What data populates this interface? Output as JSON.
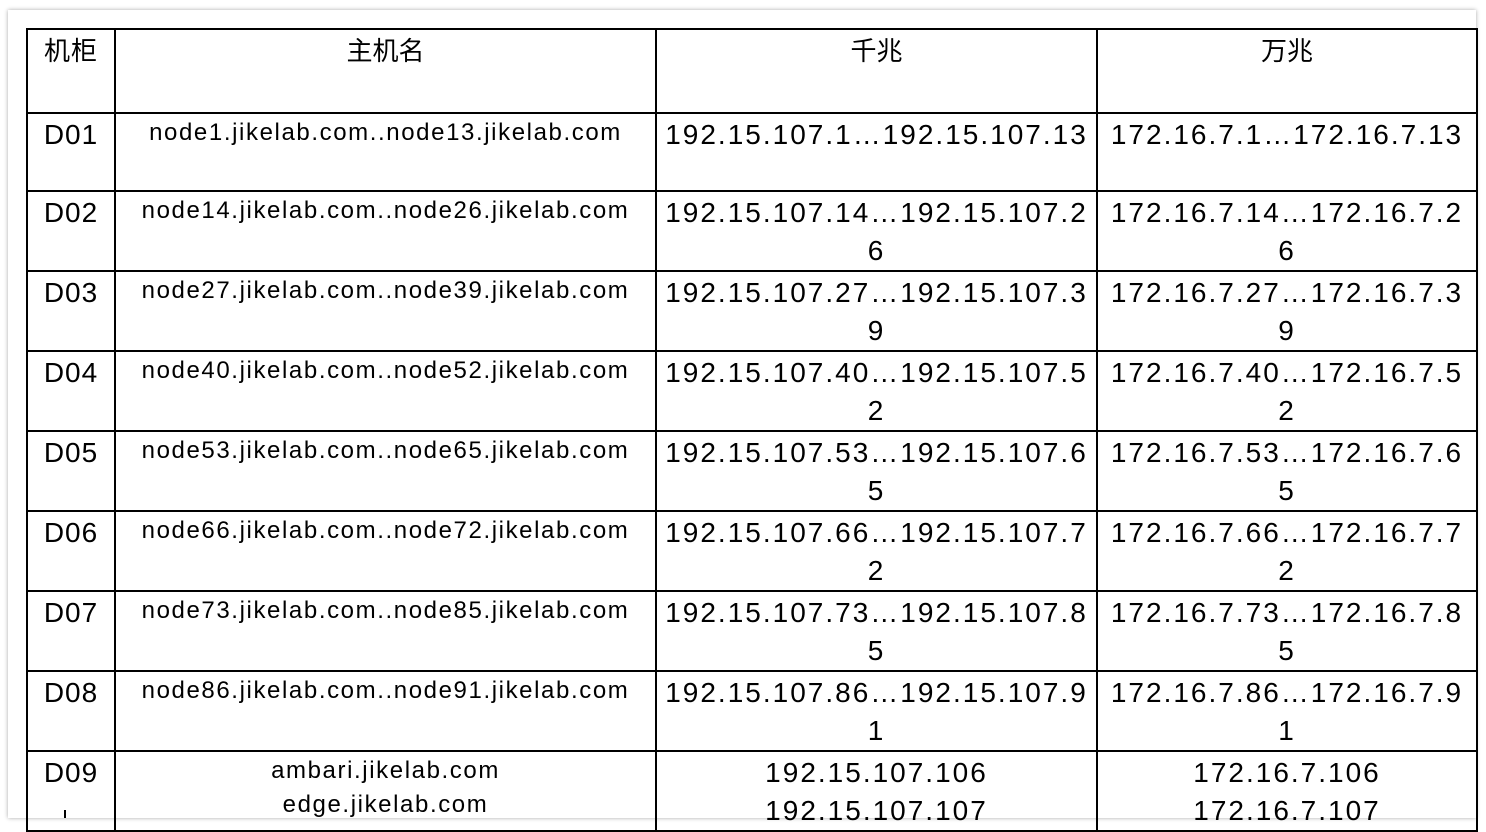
{
  "table": {
    "headers": [
      "机柜",
      "主机名",
      "千兆",
      "万兆"
    ],
    "rows": [
      {
        "rack": "D01",
        "host": "node1.jikelab.com..node13.jikelab.com",
        "gigabit": "192.15.107.1…192.15.107.13",
        "ten_gigabit": "172.16.7.1…172.16.7.13"
      },
      {
        "rack": "D02",
        "host": "node14.jikelab.com..node26.jikelab.com",
        "gigabit": "192.15.107.14…192.15.107.26",
        "ten_gigabit": "172.16.7.14…172.16.7.26"
      },
      {
        "rack": "D03",
        "host": "node27.jikelab.com..node39.jikelab.com",
        "gigabit": "192.15.107.27…192.15.107.39",
        "ten_gigabit": "172.16.7.27…172.16.7.39"
      },
      {
        "rack": "D04",
        "host": "node40.jikelab.com..node52.jikelab.com",
        "gigabit": "192.15.107.40…192.15.107.52",
        "ten_gigabit": "172.16.7.40…172.16.7.52"
      },
      {
        "rack": "D05",
        "host": "node53.jikelab.com..node65.jikelab.com",
        "gigabit": "192.15.107.53…192.15.107.65",
        "ten_gigabit": "172.16.7.53…172.16.7.65"
      },
      {
        "rack": "D06",
        "host": "node66.jikelab.com..node72.jikelab.com",
        "gigabit": "192.15.107.66…192.15.107.72",
        "ten_gigabit": "172.16.7.66…172.16.7.72"
      },
      {
        "rack": "D07",
        "host": "node73.jikelab.com..node85.jikelab.com",
        "gigabit": "192.15.107.73…192.15.107.85",
        "ten_gigabit": "172.16.7.73…172.16.7.85"
      },
      {
        "rack": "D08",
        "host": "node86.jikelab.com..node91.jikelab.com",
        "gigabit": "192.15.107.86…192.15.107.91",
        "ten_gigabit": "172.16.7.86…172.16.7.91"
      }
    ],
    "last_row": {
      "rack": "D09",
      "host": [
        "ambari.jikelab.com",
        "edge.jikelab.com"
      ],
      "gigabit": [
        "192.15.107.106",
        "192.15.107.107"
      ],
      "ten_gigabit": [
        "172.16.7.106",
        "172.16.7.107"
      ]
    }
  }
}
